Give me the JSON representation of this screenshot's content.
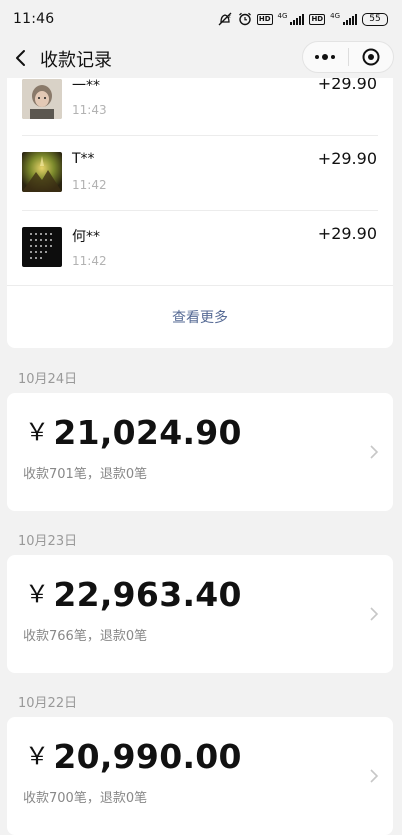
{
  "status_bar": {
    "time": "11:46",
    "hd1": "HD",
    "net1": "4G",
    "hd2": "HD",
    "net2": "4G",
    "battery": "55"
  },
  "nav": {
    "title": "收款记录"
  },
  "transactions": [
    {
      "name": "一**",
      "time": "11:43",
      "amount": "+29.90",
      "avatar": "person-photo"
    },
    {
      "name": "T**",
      "time": "11:42",
      "amount": "+29.90",
      "avatar": "landscape-photo"
    },
    {
      "name": "何**",
      "time": "11:42",
      "amount": "+29.90",
      "avatar": "dark-text-image"
    }
  ],
  "view_more": "查看更多",
  "days": [
    {
      "date": "10月24日",
      "currency": "￥",
      "total": "21,024.90",
      "summary": "收款701笔，退款0笔"
    },
    {
      "date": "10月23日",
      "currency": "￥",
      "total": "22,963.40",
      "summary": "收款766笔，退款0笔"
    },
    {
      "date": "10月22日",
      "currency": "￥",
      "total": "20,990.00",
      "summary": "收款700笔，退款0笔"
    }
  ],
  "colors": {
    "background": "#f2f2f2",
    "card": "#ffffff",
    "link": "#576b95",
    "muted": "#999999"
  }
}
